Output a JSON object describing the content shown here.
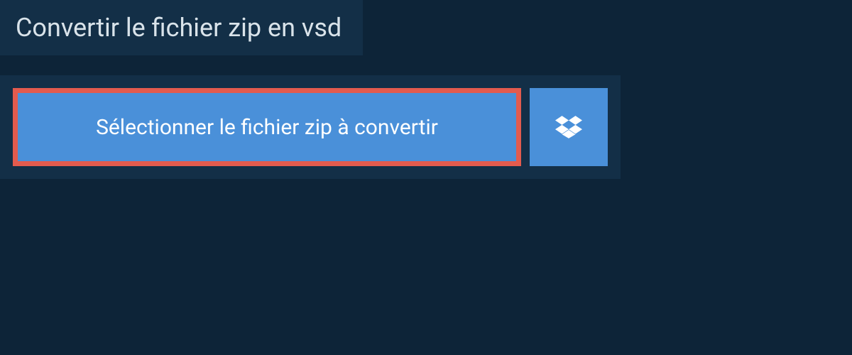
{
  "heading": "Convertir le fichier zip en vsd",
  "select_button_label": "Sélectionner le fichier zip à convertir",
  "colors": {
    "background": "#0d2438",
    "panel": "#132f47",
    "button": "#4a90d9",
    "highlight_border": "#e35b4e",
    "text_light": "#ffffff",
    "text_heading": "#d9e3ea"
  }
}
